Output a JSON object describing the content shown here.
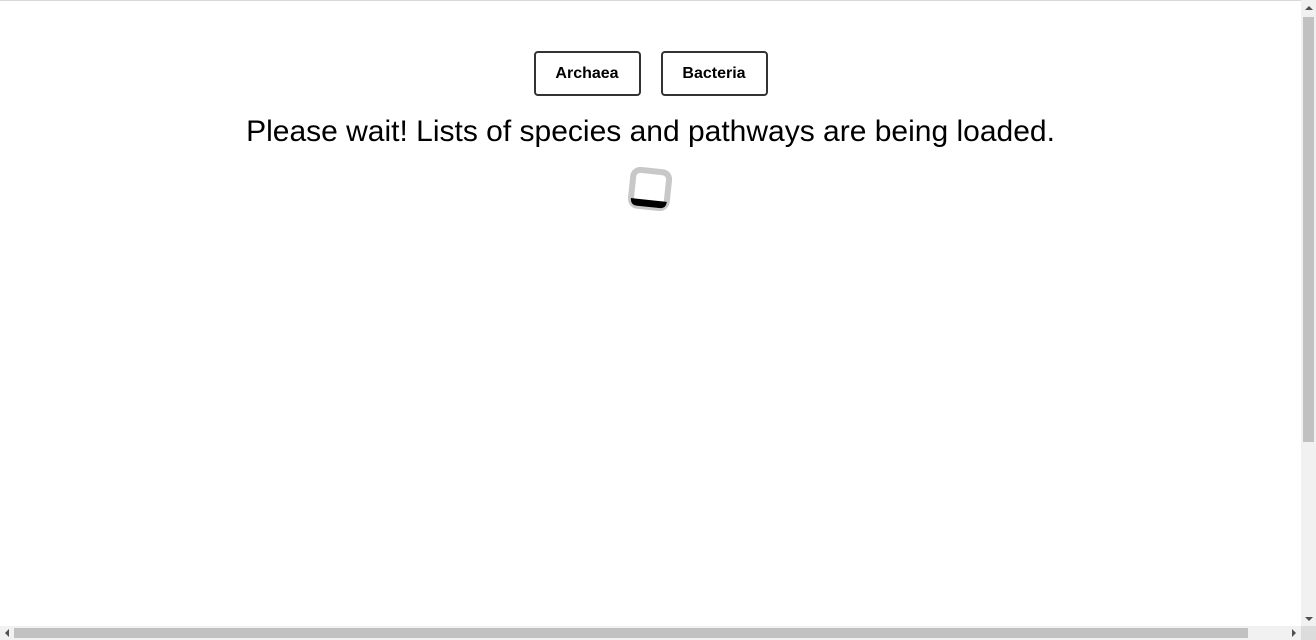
{
  "domain_buttons": [
    {
      "label": "Archaea"
    },
    {
      "label": "Bacteria"
    }
  ],
  "loading": {
    "message": "Please wait! Lists of species and pathways are being loaded.",
    "spinner_icon": "loading-spinner-icon"
  },
  "colors": {
    "background": "#ffffff",
    "text": "#000000",
    "button_border": "#333333",
    "spinner_ring": "#c8c8c8",
    "spinner_accent": "#000000"
  }
}
